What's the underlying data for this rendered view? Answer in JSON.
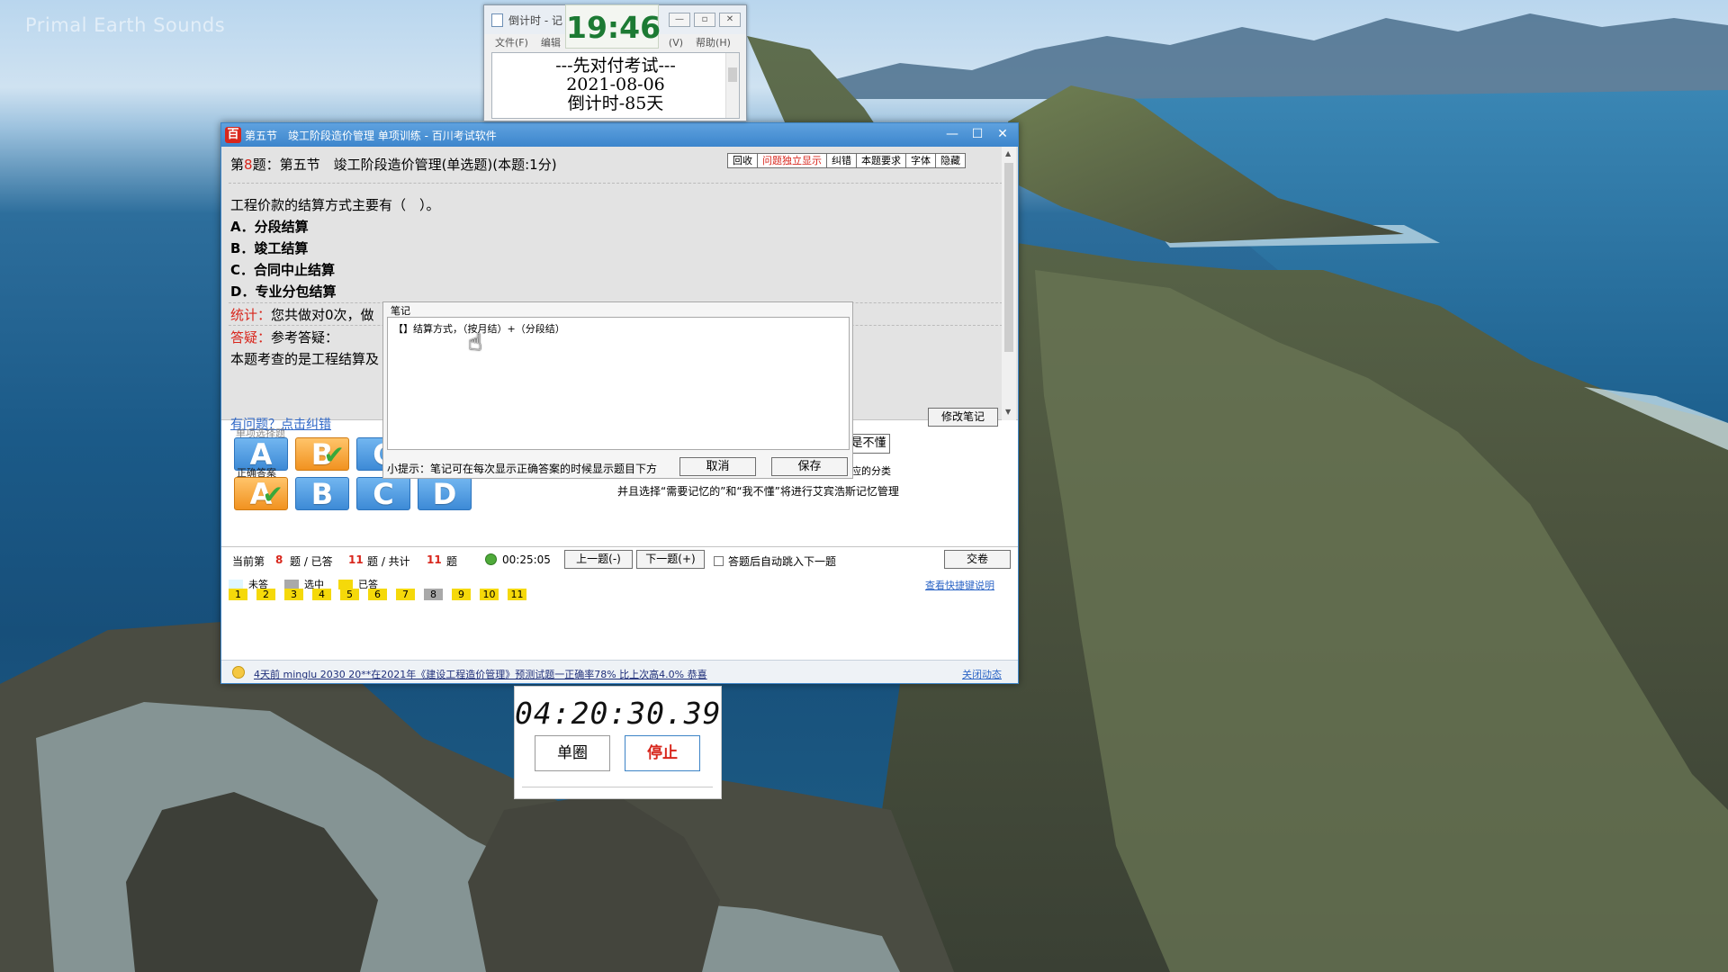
{
  "desktop": {
    "wallpaper_caption": "Primal Earth Sounds"
  },
  "countdown_window": {
    "title": "倒计时 - 记",
    "menu": [
      "文件(F)",
      "编辑",
      "(V)",
      "帮助(H)"
    ],
    "lines": [
      "---先对付考试---",
      "2021-08-06",
      "倒计时-85天"
    ],
    "clock": "19:46"
  },
  "exam_window": {
    "title": "第五节　竣工阶段造价管理 单项训练 - 百川考试软件",
    "question_header": {
      "prefix": "第",
      "number": "8",
      "text": "题：第五节　竣工阶段造价管理(单选题)(本题:1分)"
    },
    "tools": [
      "回收",
      "问题独立显示",
      "纠错",
      "本题要求",
      "字体",
      "隐藏"
    ],
    "stem": "工程价款的结算方式主要有（　）。",
    "options": [
      "A．分段结算",
      "B．竣工结算",
      "C．合同中止结算",
      "D．专业分包结算"
    ],
    "stat_label": "统计：",
    "stat_text": "您共做对0次，做",
    "doubt_label": "答疑：",
    "doubt_text": "参考答疑：",
    "explain_text": "本题考查的是工程结算及",
    "report_link": "有问题？点击纠错",
    "edit_note": "修改笔记",
    "single_choice_label": "单项选择题",
    "correct_answer_label": "正确答案",
    "choice_letters": [
      "A",
      "B",
      "C"
    ],
    "correct_letters": [
      "A",
      "B",
      "C",
      "D"
    ],
    "not_understand": "是不懂",
    "classify_text": "应的分类",
    "classify_text2": "并且选择“需要记忆的”和“我不懂”将进行艾宾浩斯记忆管理",
    "status": {
      "current_label": "当前第",
      "current": "8",
      "answered_label": "题 / 已答",
      "answered": "11",
      "total_label": "题 / 共计",
      "total": "11",
      "suffix": "题",
      "elapsed": "00:25:05",
      "prev": "上一题(-)",
      "next": "下一题(+)",
      "auto_jump": "答题后自动跳入下一题",
      "submit": "交卷"
    },
    "legend": [
      "未答",
      "选中",
      "已答"
    ],
    "shortcut_link": "查看快捷键说明",
    "grid": [
      "1",
      "2",
      "3",
      "4",
      "5",
      "6",
      "7",
      "8",
      "9",
      "10",
      "11"
    ],
    "grid_selected": "8",
    "news": "4天前 minglu 2030 20**在2021年《建设工程造价管理》预测试题一正确率78% 比上次高4.0% 恭喜",
    "close_news": "关闭动态"
  },
  "note_popup": {
    "title": "笔记",
    "content": "【】结算方式，（按月结）+（分段结）",
    "tip": "小提示：笔记可在每次显示正确答案的时候显示题目下方",
    "cancel": "取消",
    "save": "保存"
  },
  "stopwatch": {
    "time": "04:20:30.39",
    "lap": "单圈",
    "stop": "停止"
  },
  "colors": {
    "accent_red": "#d8261c",
    "title_blue": "#3c85cc",
    "answered_yellow": "#f5d90a",
    "clock_green": "#1c7a33"
  }
}
